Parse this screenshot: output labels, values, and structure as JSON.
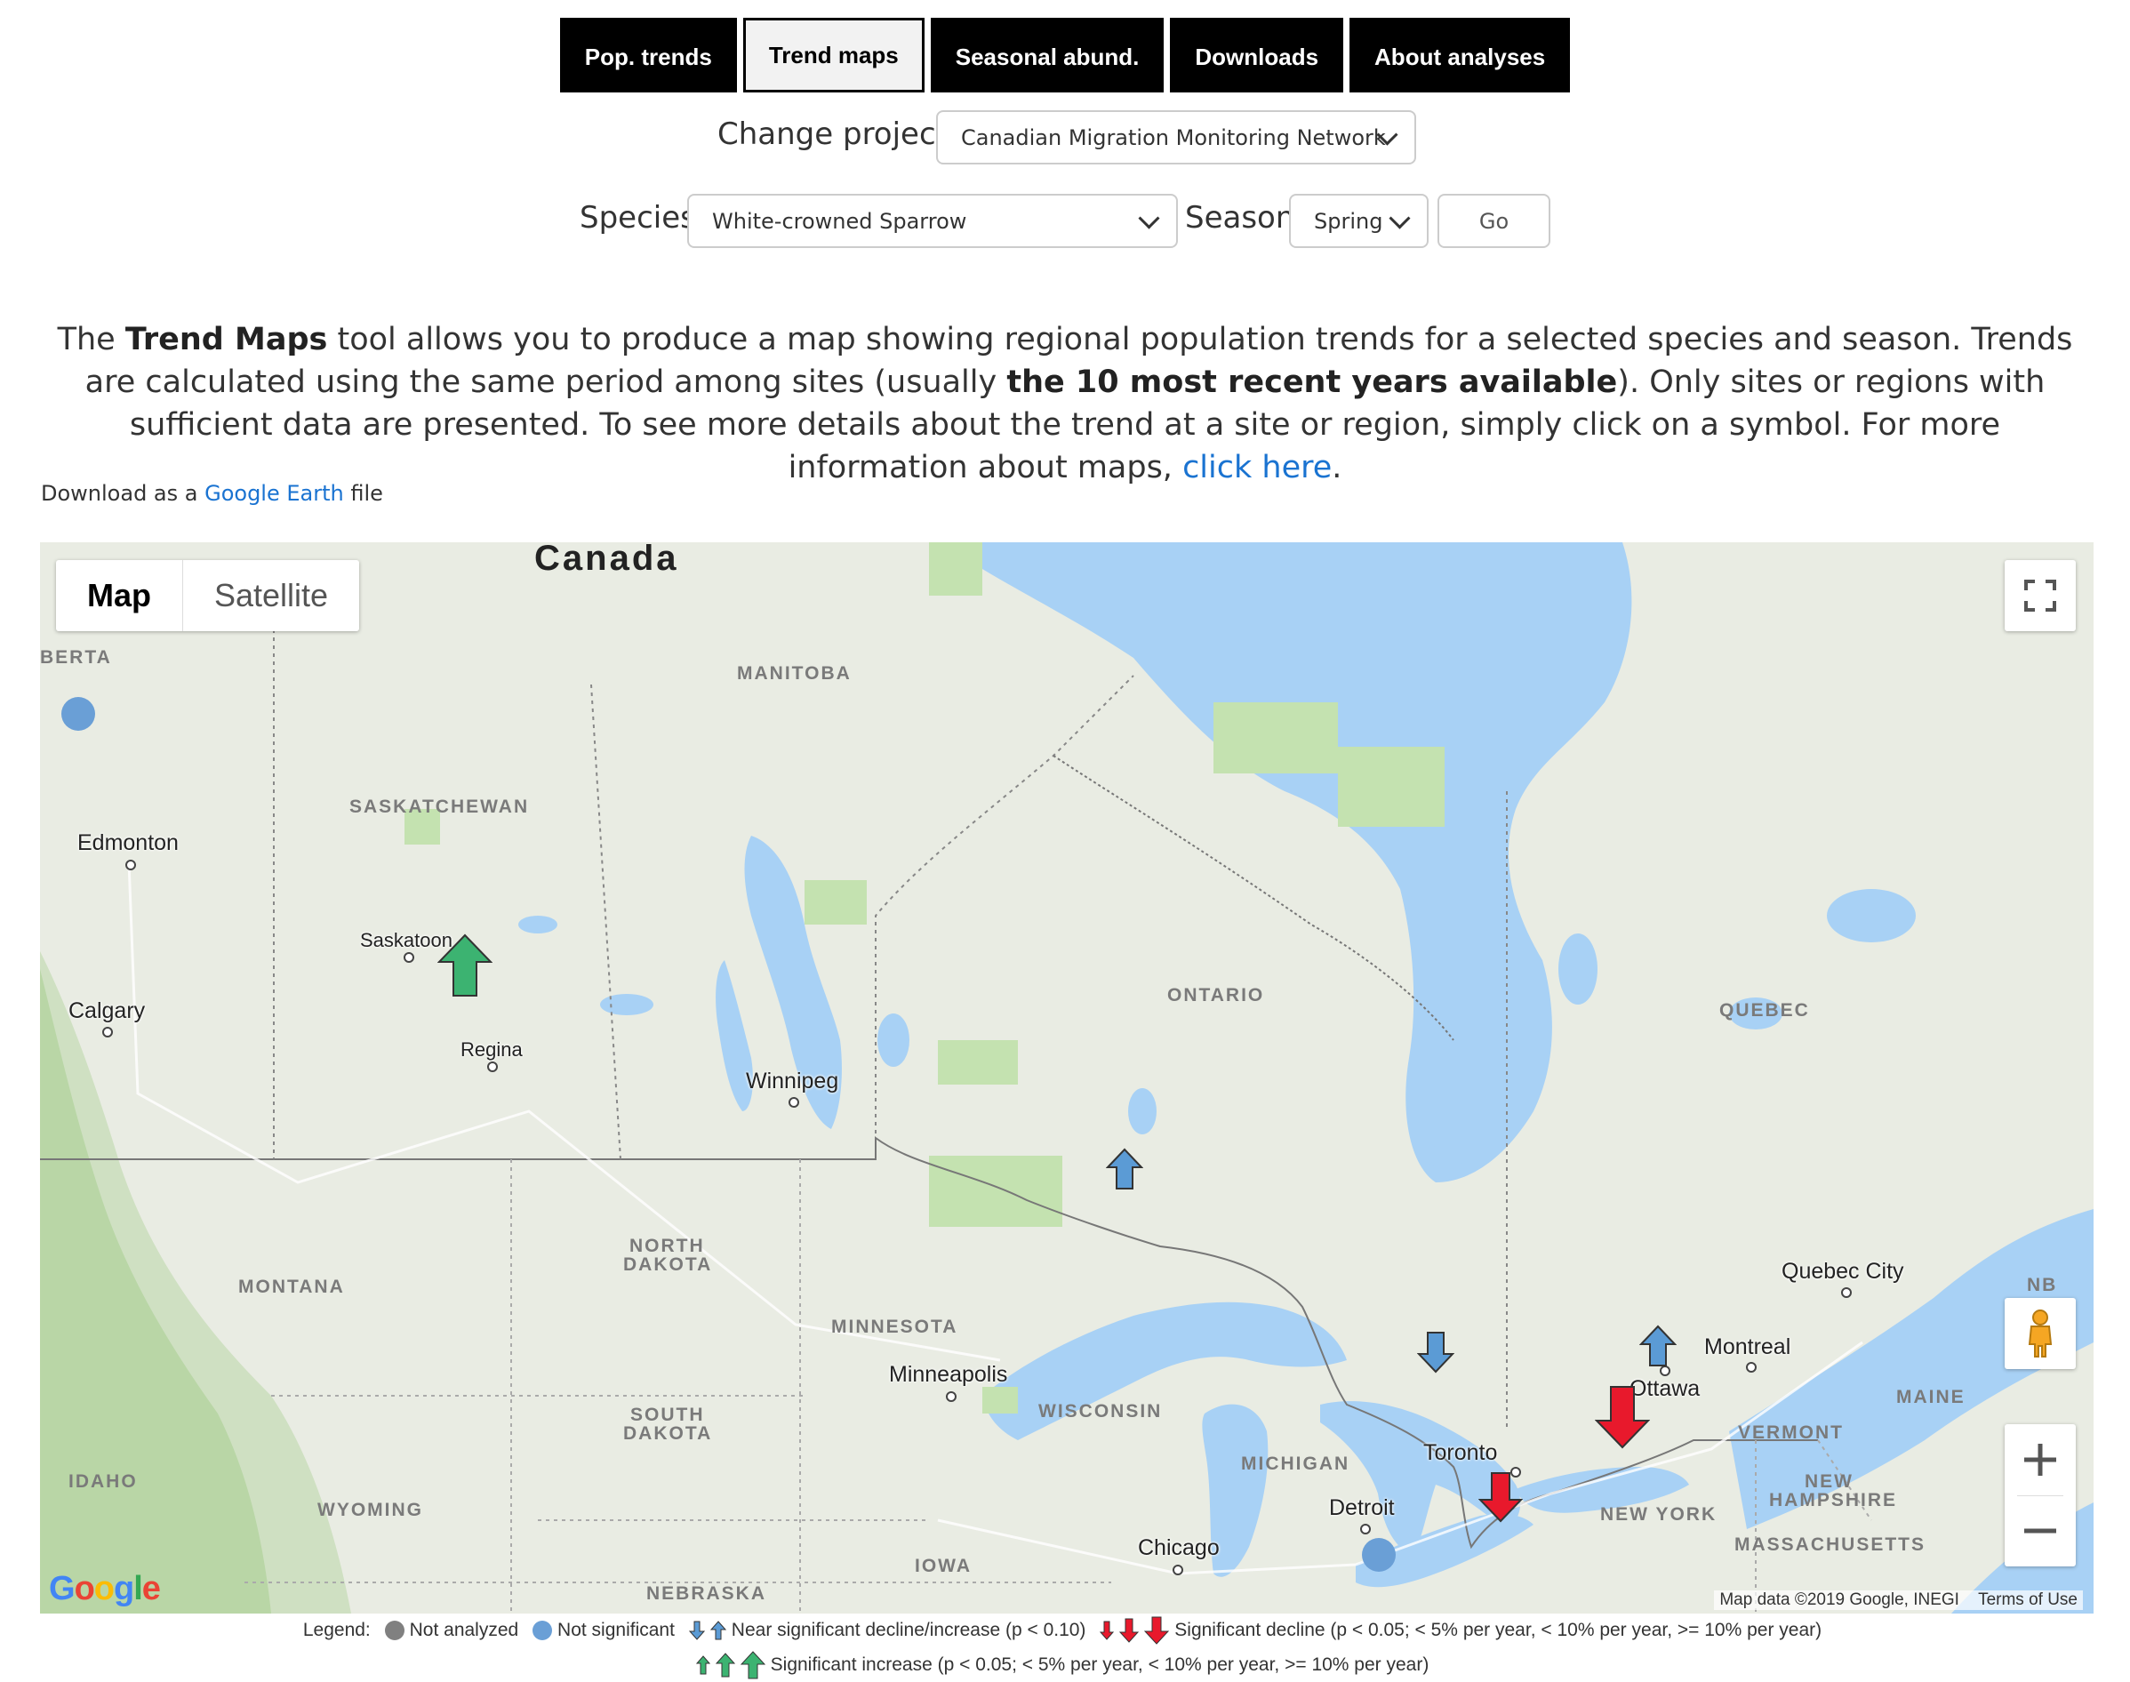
{
  "nav": {
    "tabs": [
      {
        "label": "Pop. trends",
        "active": false
      },
      {
        "label": "Trend maps",
        "active": true
      },
      {
        "label": "Seasonal abund.",
        "active": false
      },
      {
        "label": "Downloads",
        "active": false
      },
      {
        "label": "About analyses",
        "active": false
      }
    ]
  },
  "project": {
    "label": "Change project:",
    "value": "Canadian Migration Monitoring Network"
  },
  "filters": {
    "species_label": "Species",
    "species_value": "White-crowned Sparrow",
    "season_label": "Season",
    "season_value": "Spring",
    "go_label": "Go"
  },
  "intro": {
    "p1": "The ",
    "b1": "Trend Maps",
    "p2": " tool allows you to produce a map showing regional population trends for a selected species and season. Trends are calculated using the same period among sites (usually ",
    "b2": "the 10 most recent years available",
    "p3": "). Only sites or regions with sufficient data are presented. To see more details about the trend at a site or region, simply click on a symbol. For more information about maps, ",
    "link": "click here",
    "p4": "."
  },
  "download": {
    "prefix": "Download as a ",
    "link": "Google Earth",
    "suffix": " file"
  },
  "map": {
    "type_buttons": [
      "Map",
      "Satellite"
    ],
    "selected_type": "Map",
    "country_label": "Canada",
    "regions": [
      "BERTA",
      "MANITOBA",
      "SASKATCHEWAN",
      "ONTARIO",
      "QUEBEC",
      "NORTH",
      "DAKOTA",
      "MONTANA",
      "MINNESOTA",
      "SOUTH",
      "DAKOTA",
      "WISCONSIN",
      "MICHIGAN",
      "IDAHO",
      "WYOMING",
      "IOWA",
      "NEBRASKA",
      "NEW YORK",
      "VERMONT",
      "NEW",
      "HAMPSHIRE",
      "MASSACHUSETTS",
      "MAINE",
      "NB"
    ],
    "cities": [
      "Edmonton",
      "Calgary",
      "Saskatoon",
      "Regina",
      "Winnipeg",
      "Minneapolis",
      "Chicago",
      "Detroit",
      "Toronto",
      "Ottawa",
      "Montreal",
      "Quebec City"
    ],
    "credit": "Map data ©2019 Google, INEGI",
    "terms": "Terms of Use",
    "logo": "Google",
    "colors": {
      "land": "#e9ece3",
      "water": "#a8d1f5",
      "park": "#c4e2b0",
      "increase": "#3cb371",
      "decline": "#e8192c",
      "near_sig": "#5b9bd5",
      "not_sig": "#6a9fd6",
      "not_analyzed": "#808080"
    },
    "markers": [
      {
        "location": "Alberta (north)",
        "category": "not-significant"
      },
      {
        "location": "Saskatoon",
        "category": "significant-increase"
      },
      {
        "location": "Lake Superior north shore",
        "category": "near-significant-increase"
      },
      {
        "location": "Georgian Bay",
        "category": "near-significant-decline"
      },
      {
        "location": "Ottawa",
        "category": "near-significant-increase"
      },
      {
        "location": "Lake Ontario east",
        "category": "significant-decline"
      },
      {
        "location": "Toronto / Niagara",
        "category": "significant-decline"
      },
      {
        "location": "Lake Erie",
        "category": "not-significant"
      }
    ]
  },
  "legend": {
    "title": "Legend:",
    "not_analyzed": "Not analyzed",
    "not_significant": "Not significant",
    "near_sig": "Near significant decline/increase (p < 0.10)",
    "sig_decline": "Significant decline (p < 0.05; < 5% per year, < 10% per year, >= 10% per year)",
    "sig_increase": "Significant increase (p < 0.05; < 5% per year, < 10% per year, >= 10% per year)"
  }
}
